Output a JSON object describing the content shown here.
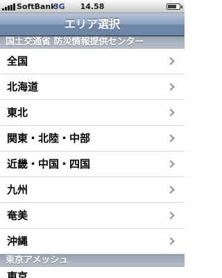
{
  "status_bar": {
    "carrier": "SoftBank",
    "network": "3G",
    "time": "14.58"
  },
  "navbar": {
    "title": "エリア選択"
  },
  "sections": [
    {
      "header": "国土交通省 防災情報提供センター",
      "rows": [
        {
          "label": "全国"
        },
        {
          "label": "北海道"
        },
        {
          "label": "東北"
        },
        {
          "label": "関東・北陸・中部"
        },
        {
          "label": "近畿・中国・四国"
        },
        {
          "label": "九州"
        },
        {
          "label": "奄美"
        },
        {
          "label": "沖縄"
        }
      ]
    },
    {
      "header": "東京アメッシュ",
      "rows": [
        {
          "label": "東京"
        }
      ]
    }
  ]
}
